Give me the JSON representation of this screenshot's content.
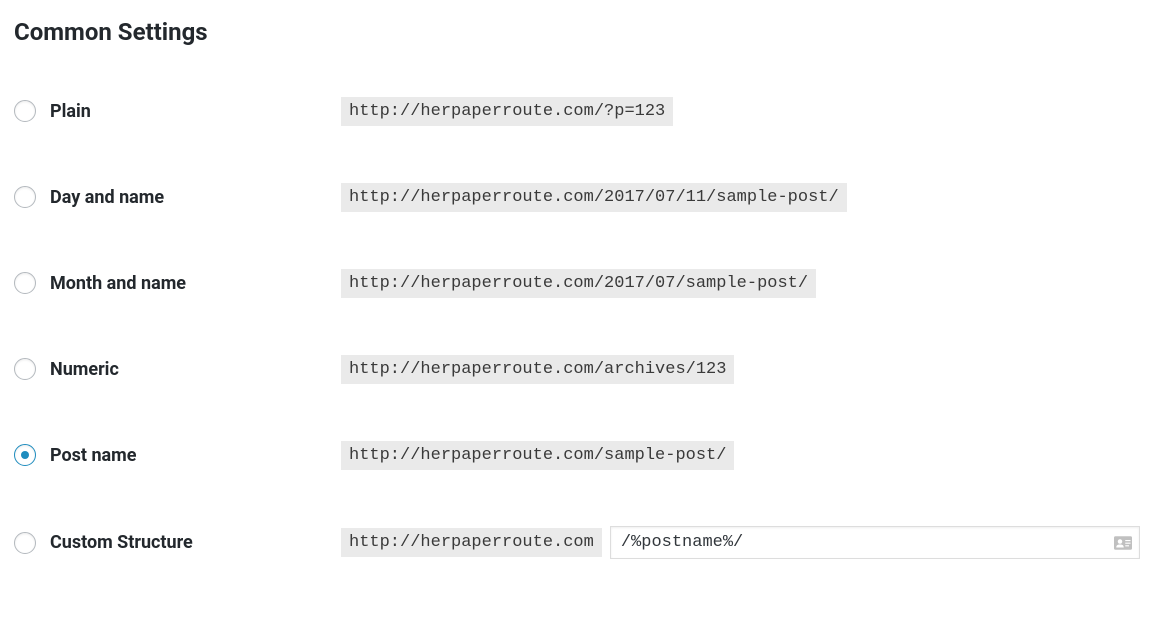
{
  "heading": "Common Settings",
  "options": [
    {
      "label": "Plain",
      "example": "http://herpaperroute.com/?p=123",
      "selected": false
    },
    {
      "label": "Day and name",
      "example": "http://herpaperroute.com/2017/07/11/sample-post/",
      "selected": false
    },
    {
      "label": "Month and name",
      "example": "http://herpaperroute.com/2017/07/sample-post/",
      "selected": false
    },
    {
      "label": "Numeric",
      "example": "http://herpaperroute.com/archives/123",
      "selected": false
    },
    {
      "label": "Post name",
      "example": "http://herpaperroute.com/sample-post/",
      "selected": true
    }
  ],
  "custom": {
    "label": "Custom Structure",
    "prefix": "http://herpaperroute.com",
    "value": "/%postname%/",
    "selected": false
  }
}
